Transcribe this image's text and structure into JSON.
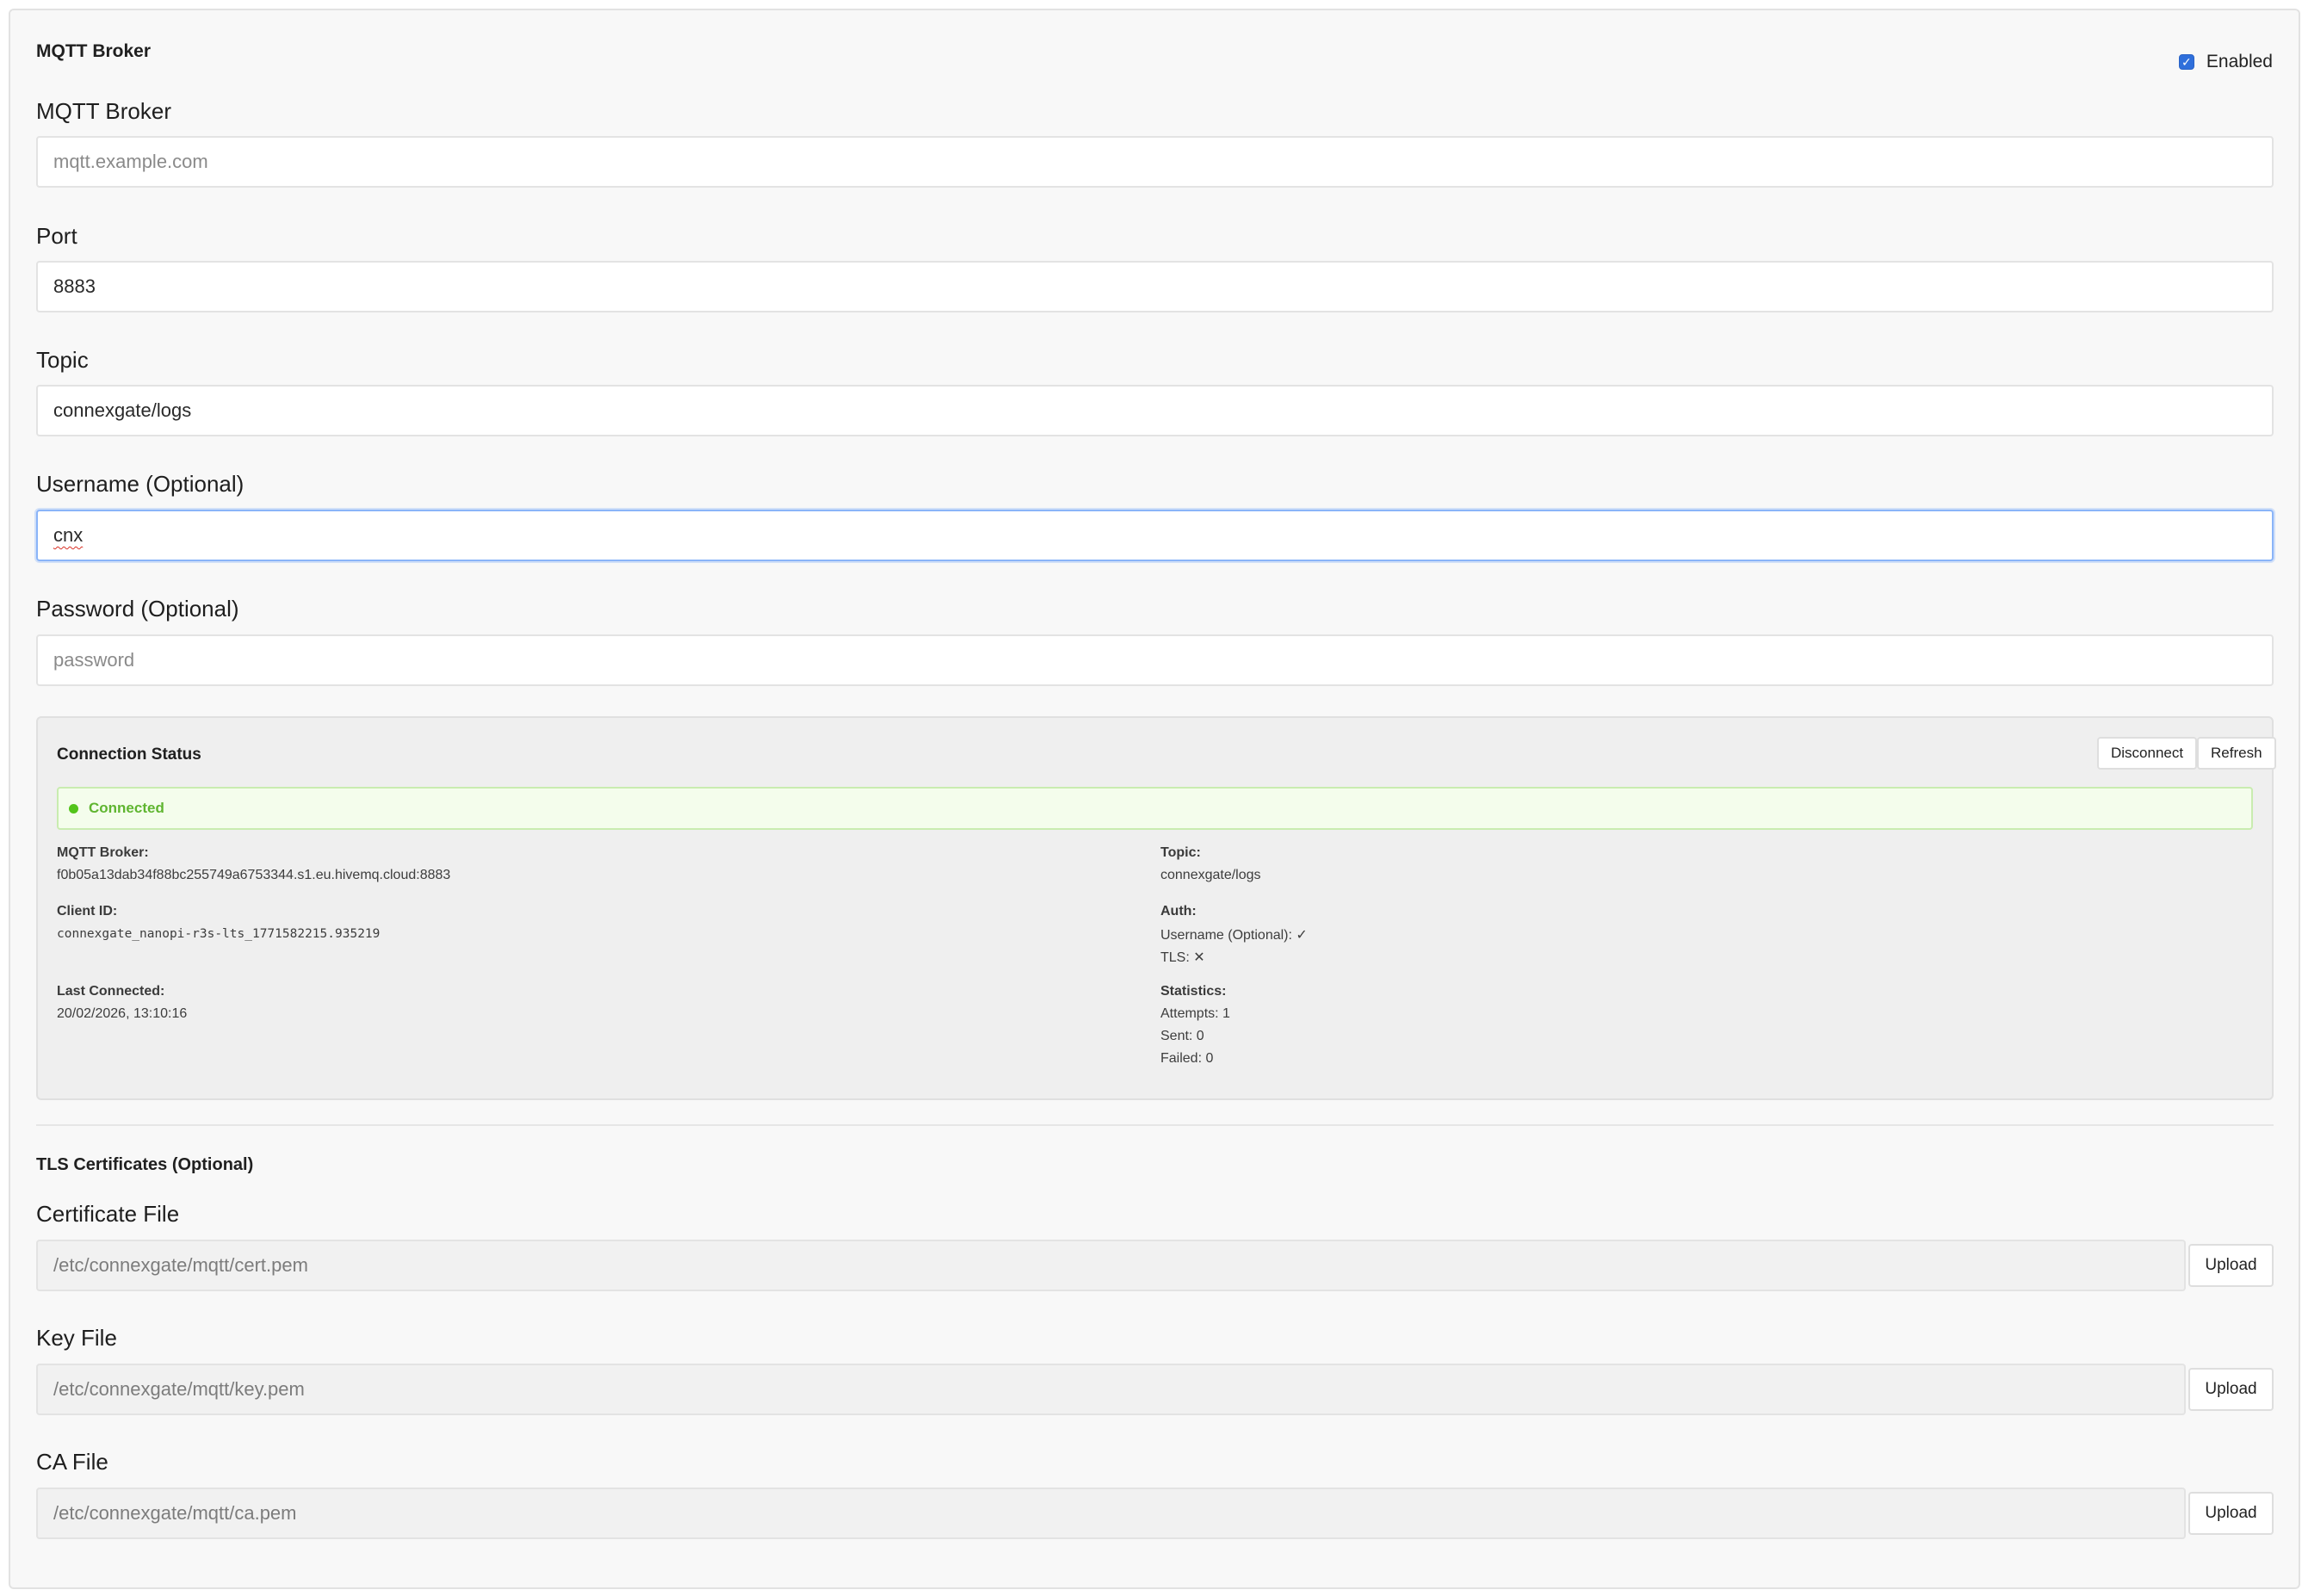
{
  "panel": {
    "title": "MQTT Broker",
    "enabled_label": "Enabled",
    "enabled_checked": true
  },
  "fields": {
    "broker": {
      "label": "MQTT Broker",
      "value": "",
      "placeholder": "mqtt.example.com"
    },
    "port": {
      "label": "Port",
      "value": "8883"
    },
    "topic": {
      "label": "Topic",
      "value": "connexgate/logs"
    },
    "username": {
      "label": "Username (Optional)",
      "value": "cnx"
    },
    "password": {
      "label": "Password (Optional)",
      "value": "",
      "placeholder": "password"
    }
  },
  "status": {
    "title": "Connection Status",
    "disconnect_label": "Disconnect",
    "refresh_label": "Refresh",
    "state": "Connected",
    "state_color": "#52c41a",
    "broker_label": "MQTT Broker:",
    "broker_value": "f0b05a13dab34f88bc255749a6753344.s1.eu.hivemq.cloud:8883",
    "client_id_label": "Client ID:",
    "client_id_value": "connexgate_nanopi-r3s-lts_1771582215.935219",
    "last_connected_label": "Last Connected:",
    "last_connected_value": "20/02/2026, 13:10:16",
    "topic_label": "Topic:",
    "topic_value": "connexgate/logs",
    "auth_label": "Auth:",
    "auth_username": "Username (Optional): ✓",
    "auth_tls": "TLS: ✕",
    "stats_label": "Statistics:",
    "stats_attempts": "Attempts: 1",
    "stats_sent": "Sent: 0",
    "stats_failed": "Failed: 0"
  },
  "tls": {
    "title": "TLS Certificates (Optional)",
    "upload_label": "Upload",
    "cert": {
      "label": "Certificate File",
      "value": "/etc/connexgate/mqtt/cert.pem"
    },
    "key": {
      "label": "Key File",
      "value": "/etc/connexgate/mqtt/key.pem"
    },
    "ca": {
      "label": "CA File",
      "value": "/etc/connexgate/mqtt/ca.pem"
    }
  }
}
